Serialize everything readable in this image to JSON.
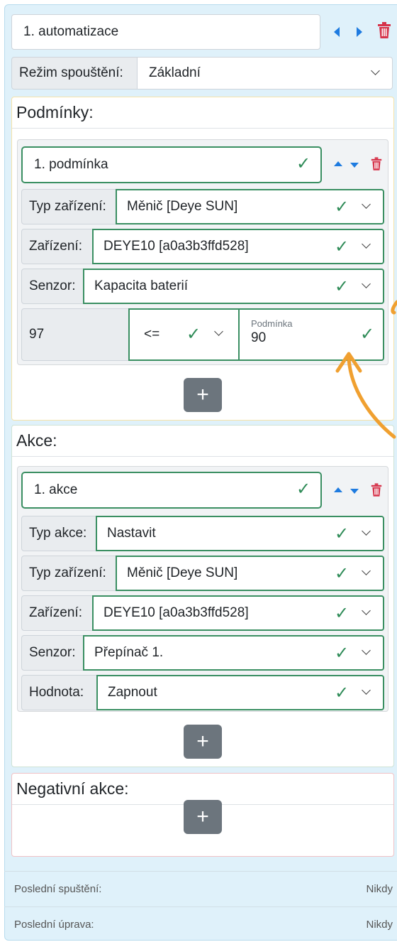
{
  "automation": {
    "name": "1. automatizace",
    "mode_label": "Režim spouštění:",
    "mode_value": "Základní"
  },
  "conditions": {
    "title": "Podmínky:",
    "item": {
      "name": "1. podmínka",
      "device_type_label": "Typ zařízení:",
      "device_type_value": "Měnič [Deye SUN]",
      "device_label": "Zařízení:",
      "device_value": "DEYE10 [a0a3b3ffd528]",
      "sensor_label": "Senzor:",
      "sensor_value": "Kapacita baterií",
      "current_value": "97",
      "operator": "<=",
      "condition_label": "Podmínka",
      "condition_value": "90"
    },
    "add_label": "+"
  },
  "actions": {
    "title": "Akce:",
    "item": {
      "name": "1. akce",
      "action_type_label": "Typ akce:",
      "action_type_value": "Nastavit",
      "device_type_label": "Typ zařízení:",
      "device_type_value": "Měnič [Deye SUN]",
      "device_label": "Zařízení:",
      "device_value": "DEYE10 [a0a3b3ffd528]",
      "sensor_label": "Senzor:",
      "sensor_value": "Přepínač 1.",
      "value_label": "Hodnota:",
      "value_value": "Zapnout"
    },
    "add_label": "+"
  },
  "negative_actions": {
    "title": "Negativní akce:",
    "add_label": "+"
  },
  "footer": {
    "last_run_label": "Poslední spuštění:",
    "last_run_value": "Nikdy",
    "last_edit_label": "Poslední úprava:",
    "last_edit_value": "Nikdy"
  },
  "colors": {
    "panel_bg": "#dff1fa",
    "valid_green": "#3a8f62",
    "conditions_border": "#f6e3a8",
    "actions_border": "#cfe3d6",
    "negative_border": "#f0c2c6",
    "nav_blue": "#1e7be0",
    "delete_red": "#d6334a",
    "annotation_orange": "#f0a030"
  },
  "icons": [
    "chevron-left-icon",
    "chevron-right-icon",
    "trash-icon",
    "arrow-up-icon",
    "arrow-down-icon",
    "check-icon",
    "chevron-down-icon",
    "plus-icon",
    "curved-arrow-annotation"
  ]
}
